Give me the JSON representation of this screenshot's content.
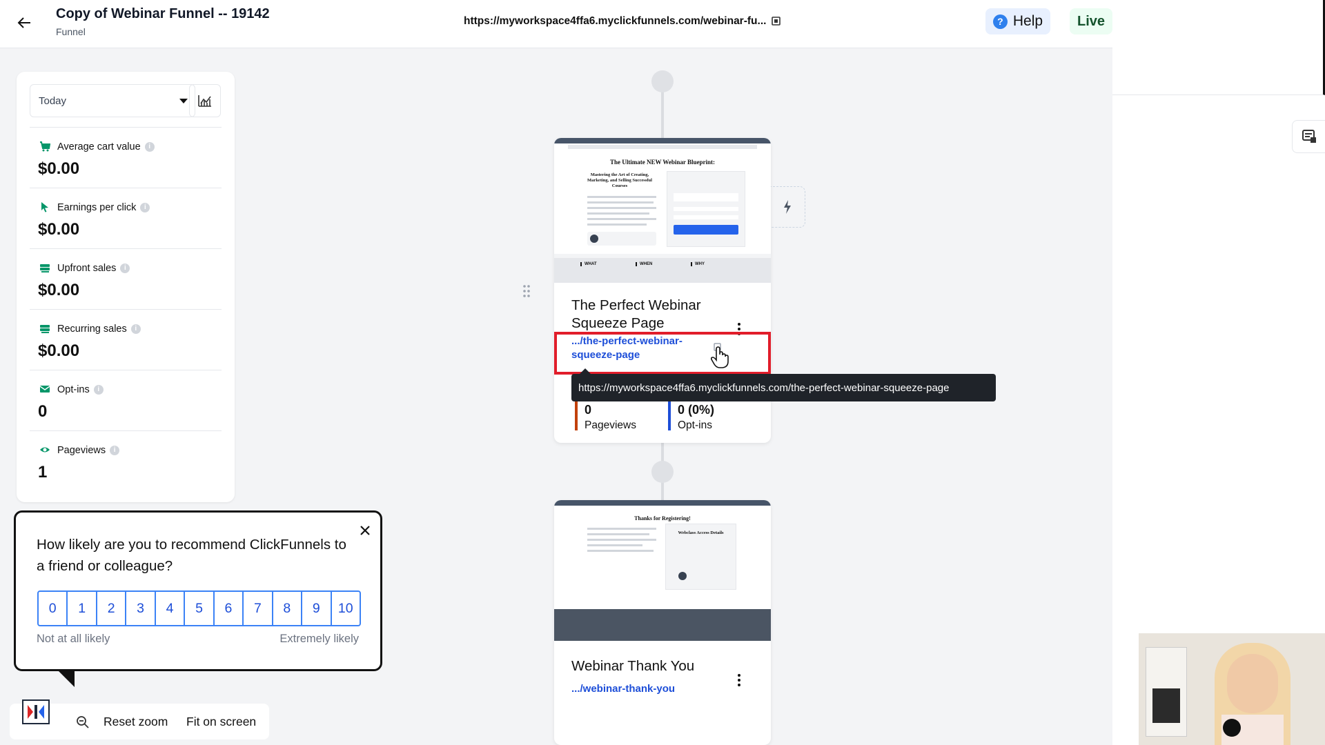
{
  "header": {
    "title": "Copy of Webinar Funnel -- 19142",
    "subtitle": "Funnel",
    "url": "https://myworkspace4ffa6.myclickfunnels.com/webinar-fu...",
    "help_label": "Help",
    "live_label": "Live"
  },
  "stats": {
    "range": "Today",
    "items": [
      {
        "label": "Average cart value",
        "value": "$0.00",
        "icon": "cart-icon"
      },
      {
        "label": "Earnings per click",
        "value": "$0.00",
        "icon": "cursor-icon"
      },
      {
        "label": "Upfront sales",
        "value": "$0.00",
        "icon": "money-icon"
      },
      {
        "label": "Recurring sales",
        "value": "$0.00",
        "icon": "money-icon"
      },
      {
        "label": "Opt-ins",
        "value": "0",
        "icon": "mail-icon"
      },
      {
        "label": "Pageviews",
        "value": "1",
        "icon": "eye-icon"
      }
    ]
  },
  "pages": [
    {
      "title_line1": "The Perfect Webinar",
      "title_line2": "Squeeze Page",
      "slug_line1": ".../the-perfect-webinar-",
      "slug_line2": "squeeze-page",
      "tooltip": "https://myworkspace4ffa6.myclickfunnels.com/the-perfect-webinar-squeeze-page",
      "pageviews_value": "0",
      "pageviews_label": "Pageviews",
      "optins_value": "0 (0%)",
      "optins_label": "Opt-ins",
      "thumb_headline": "The Ultimate NEW Webinar Blueprint:",
      "thumb_sub": "Mastering the Art of Creating, Marketing, and Selling Successful Courses",
      "thumb_cols": [
        "WHAT",
        "WHEN",
        "WHY"
      ]
    },
    {
      "title_line1": "Webinar Thank You",
      "slug_line1": ".../webinar-thank-you",
      "thumb_headline": "Thanks for Registering!",
      "thumb_sub": "Webclass Access Details"
    }
  ],
  "nps": {
    "question": "How likely are you to recommend ClickFunnels to a friend or colleague?",
    "scale": [
      "0",
      "1",
      "2",
      "3",
      "4",
      "5",
      "6",
      "7",
      "8",
      "9",
      "10"
    ],
    "low_label": "Not at all likely",
    "high_label": "Extremely likely"
  },
  "zoom": {
    "reset_label": "Reset zoom",
    "fit_label": "Fit on screen"
  },
  "colors": {
    "accent_blue": "#1d4ed8",
    "highlight_red": "#e11d2a",
    "pageviews_bar": "#c2410c",
    "optins_bar": "#1d4ed8"
  }
}
